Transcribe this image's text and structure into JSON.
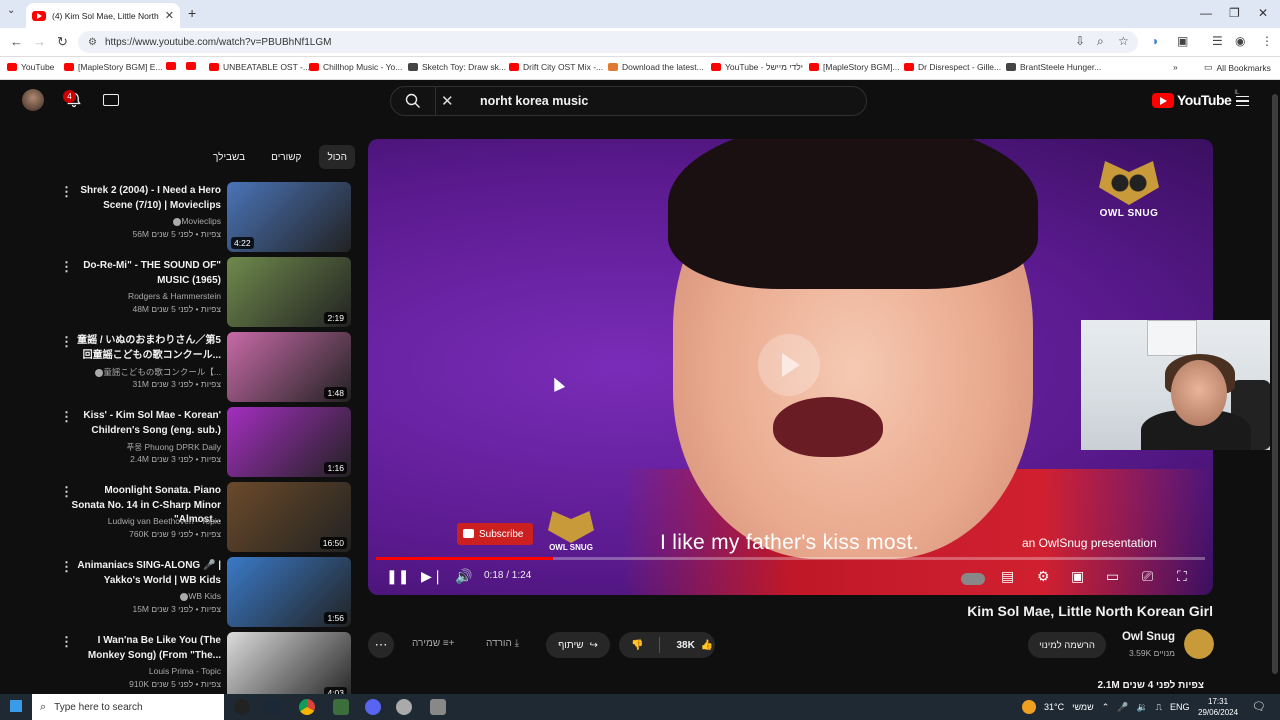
{
  "browser": {
    "tab_title": "(4) Kim Sol Mae, Little North K...",
    "url": "https://www.youtube.com/watch?v=PBUBhNf1LGM",
    "bookmarks": [
      "YouTube",
      "[MapleStory BGM] E...",
      "UNBEATABLE OST -...",
      "Chillhop Music - Yo...",
      "Sketch Toy: Draw sk...",
      "Drift City OST Mix -...",
      "Download the latest...",
      "YouTube - ילדי מיישל",
      "[MapleStory BGM]...",
      "Dr Disrespect - Gille...",
      "BrantSteele Hunger..."
    ],
    "all_bookmarks": "All Bookmarks"
  },
  "header": {
    "notifications_count": "4",
    "search_value": "norht korea music",
    "logo_text": "YouTube",
    "logo_country": "IL"
  },
  "chips": [
    "בשבילך",
    "קשורים",
    "הכול"
  ],
  "recommendations": [
    {
      "title": "Shrek 2 (2004) - I Need a Hero Scene (7/10) | Movieclips",
      "channel": "Movieclips",
      "verified": true,
      "meta": "56M צפיות • לפני 5 שנים",
      "duration": "4:22",
      "thumb_color": "#4a74b8"
    },
    {
      "title": "Do-Re-Mi\" - THE SOUND OF\" MUSIC (1965)",
      "channel": "Rodgers & Hammerstein",
      "verified": false,
      "meta": "48M צפיות • לפני 5 שנים",
      "duration": "2:19",
      "thumb_color": "#6f8a4c"
    },
    {
      "title": "童謡 / いぬのおまわりさん／第5回童謡こどもの歌コンクール...",
      "channel": "童謡こどもの歌コンクール【...",
      "verified": true,
      "meta": "31M צפיות • לפני 3 שנים",
      "duration": "1:48",
      "thumb_color": "#c86aa8"
    },
    {
      "title": "Kiss' - Kim Sol Mae - Korean' Children's Song (eng. sub.)",
      "channel": "푸웅 Phuong DPRK Daily",
      "verified": false,
      "meta": "2.4M צפיות • לפני 3 שנים",
      "duration": "1:16",
      "thumb_color": "#a42ec0"
    },
    {
      "title": "Moonlight Sonata. Piano Sonata No. 14 in C-Sharp Minor \"Almost...",
      "channel": "Ludwig van Beethoven - Topic",
      "verified": false,
      "meta": "760K צפיות • לפני 9 שנים",
      "duration": "16:50",
      "thumb_color": "#6b4a2a"
    },
    {
      "title": "Animaniacs SING-ALONG 🎤 | Yakko's World | WB Kids",
      "channel": "WB Kids",
      "verified": true,
      "meta": "15M צפיות • לפני 3 שנים",
      "duration": "1:56",
      "thumb_color": "#3a7ac8"
    },
    {
      "title": "I Wan'na Be Like You (The Monkey Song) (From \"The...",
      "channel": "Louis Prima - Topic",
      "verified": false,
      "meta": "910K צפיות • לפני 5 שנים",
      "duration": "4:03",
      "thumb_color": "#dcdcdc"
    }
  ],
  "player": {
    "watermark": "OWL SNUG",
    "subscribe_badge": "Subscribe",
    "caption": "I like my father's kiss most.",
    "presentation": "an OwlSnug presentation",
    "time": "0:18 / 1:24",
    "progress": 0.214
  },
  "video": {
    "title": "Kim Sol Mae, Little North Korean Girl",
    "channel": "Owl Snug",
    "subscribers": "3.59K מנויים",
    "join": "הרשמה למינוי",
    "likes": "38K",
    "share": "שיתוף",
    "download": "הורדה",
    "save": "שמירה",
    "views_line": "2.1M צפיות לפני 4 שנים"
  },
  "taskbar": {
    "search_placeholder": "Type here to search",
    "weather": "31°C",
    "weather_label": "שמשי",
    "lang": "ENG",
    "time": "17:31",
    "date": "29/06/2024"
  }
}
